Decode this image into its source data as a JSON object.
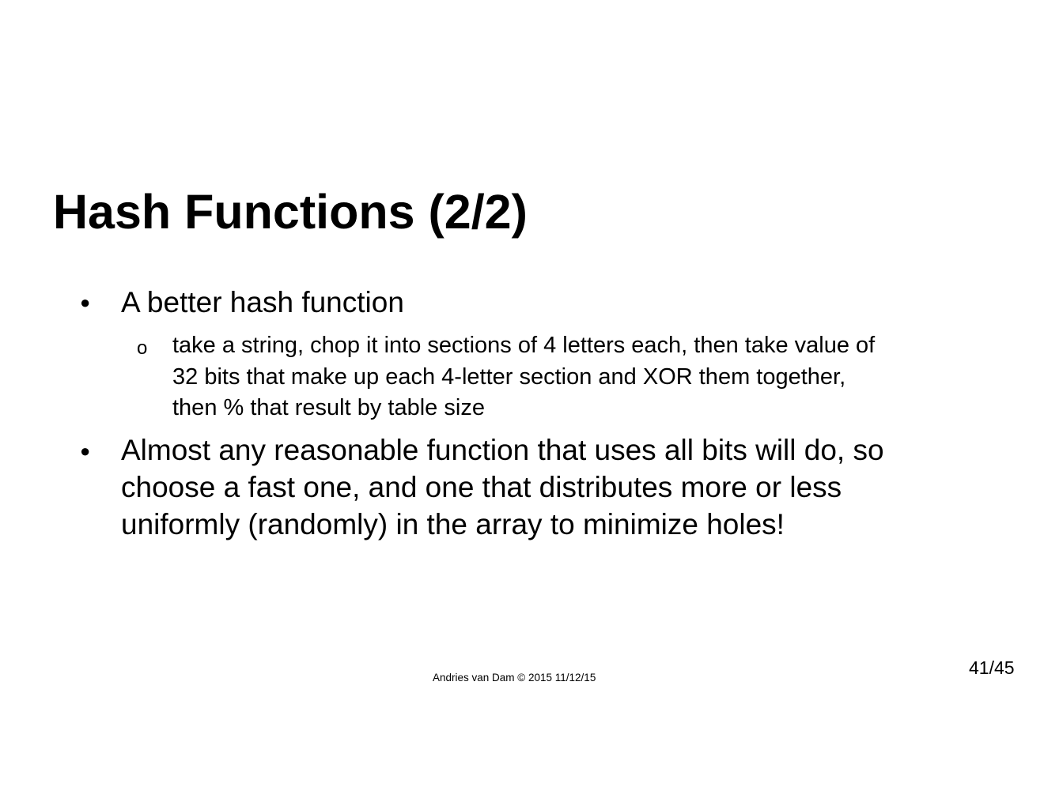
{
  "slide": {
    "title": "Hash Functions (2/2)",
    "bullets": [
      {
        "marker": "●",
        "lines": [
          "A better hash function"
        ],
        "subbullets": [
          {
            "marker": "o",
            "lines": [
              "take a string, chop it into sections of 4 letters each, then take value of",
              "32 bits that make up each 4-letter section and XOR them together,",
              "then % that result by table size"
            ]
          }
        ]
      },
      {
        "marker": "●",
        "lines": [
          "Almost any reasonable function that uses all bits will do, so",
          "choose a fast one, and one that distributes more or less",
          "uniformly (randomly) in the array to minimize holes!"
        ]
      }
    ],
    "footer": {
      "credit": "Andries van Dam © 2015 11/12/15",
      "page_number": "41/45"
    }
  }
}
